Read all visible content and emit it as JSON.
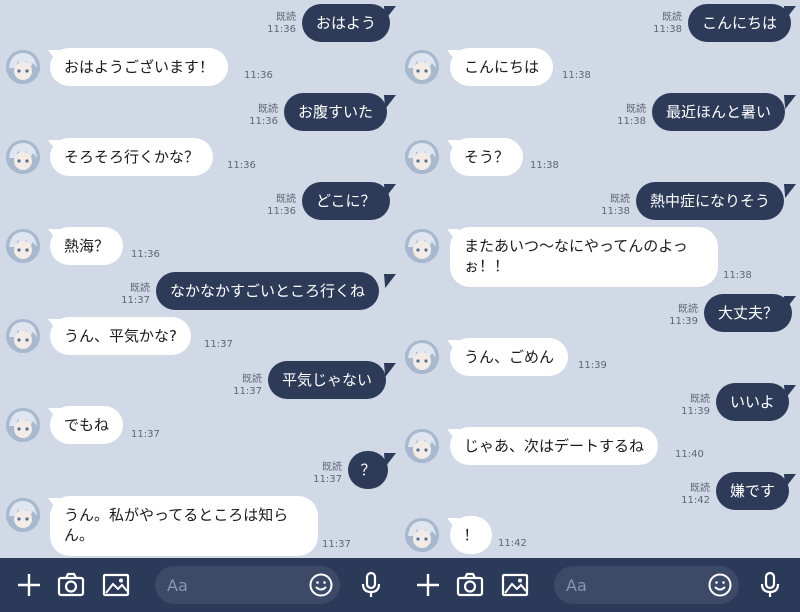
{
  "left": {
    "read_label": "既読",
    "input_placeholder": "Aa",
    "messages": [
      {
        "text": "おはよう",
        "time": "11:36"
      },
      {
        "text": "おはようございます！",
        "time": "11:36"
      },
      {
        "text": "お腹すいた",
        "time": "11:36"
      },
      {
        "text": "そろそろ行くかな？",
        "time": "11:36"
      },
      {
        "text": "どこに？",
        "time": "11:36"
      },
      {
        "text": "熱海？",
        "time": "11:36"
      },
      {
        "text": "なかなかすごいところ行くね",
        "time": "11:37"
      },
      {
        "text": "うん、平気かな?",
        "time": "11:37"
      },
      {
        "text": "平気じゃない",
        "time": "11:37"
      },
      {
        "text": "でもね",
        "time": "11:37"
      },
      {
        "text": "？",
        "time": "11:37"
      },
      {
        "text": "うん。私がやってるところは知らん。",
        "time": "11:37"
      }
    ]
  },
  "right": {
    "read_label": "既読",
    "input_placeholder": "Aa",
    "messages": [
      {
        "text": "こんにちは",
        "time": "11:38"
      },
      {
        "text": "こんにちは",
        "time": "11:38"
      },
      {
        "text": "最近ほんと暑い",
        "time": "11:38"
      },
      {
        "text": "そう？",
        "time": "11:38"
      },
      {
        "text": "熱中症になりそう",
        "time": "11:38"
      },
      {
        "text": "またあいつ〜なにやってんのよっぉ！！",
        "time": "11:38"
      },
      {
        "text": "大丈夫？",
        "time": "11:39"
      },
      {
        "text": "うん、ごめん",
        "time": "11:39"
      },
      {
        "text": "いいよ",
        "time": "11:39"
      },
      {
        "text": "じゃあ、次はデートするね",
        "time": "11:40"
      },
      {
        "text": "嫌です",
        "time": "11:42"
      },
      {
        "text": "！",
        "time": "11:42"
      }
    ]
  },
  "colors": {
    "background": "#d1d8e6",
    "self_bubble": "#2d3b59",
    "other_bubble": "#ffffff",
    "toolbar": "#2b3a58"
  },
  "icons": {
    "add": "plus-icon",
    "camera": "camera-icon",
    "image": "image-icon",
    "emoji": "smiley-icon",
    "mic": "microphone-icon"
  }
}
